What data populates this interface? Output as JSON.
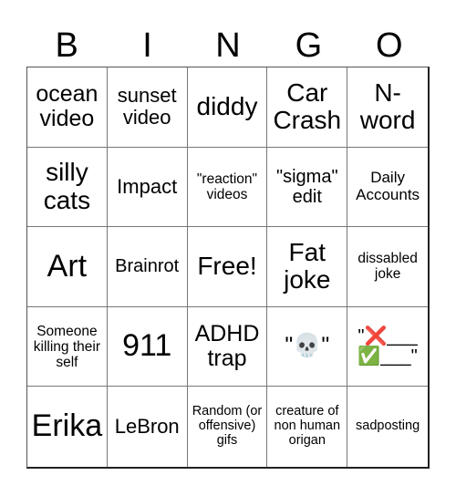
{
  "header": [
    "B",
    "I",
    "N",
    "G",
    "O"
  ],
  "cells": [
    {
      "text": "ocean video",
      "size": "s3"
    },
    {
      "text": "sunset video",
      "size": "s4"
    },
    {
      "text": "diddy",
      "size": "s2"
    },
    {
      "text": "Car Crash",
      "size": "s2"
    },
    {
      "text": "N-word",
      "size": "s2"
    },
    {
      "text": "silly cats",
      "size": "s2"
    },
    {
      "text": "Impact",
      "size": "s4"
    },
    {
      "text": "\"reaction\" videos",
      "size": "s7"
    },
    {
      "text": "\"sigma\" edit",
      "size": "s5"
    },
    {
      "text": "Daily Accounts",
      "size": "s6"
    },
    {
      "text": "Art",
      "size": "s1"
    },
    {
      "text": "Brainrot",
      "size": "s5"
    },
    {
      "text": "Free!",
      "size": "s2"
    },
    {
      "text": "Fat joke",
      "size": "s2"
    },
    {
      "text": "dissabled joke",
      "size": "s7"
    },
    {
      "text": "Someone killing their self",
      "size": "s7"
    },
    {
      "text": "911",
      "size": "s1"
    },
    {
      "text": "ADHD trap",
      "size": "s3"
    },
    {
      "text": "\"💀\"",
      "size": "s3"
    },
    {
      "text": "\"❌___ ✅___\"",
      "size": "s5"
    },
    {
      "text": "Erika",
      "size": "s1"
    },
    {
      "text": "LeBron",
      "size": "s4"
    },
    {
      "text": "Random (or offensive) gifs",
      "size": "s8"
    },
    {
      "text": "creature of non human origan",
      "size": "s8"
    },
    {
      "text": "sadposting",
      "size": "s8"
    }
  ]
}
